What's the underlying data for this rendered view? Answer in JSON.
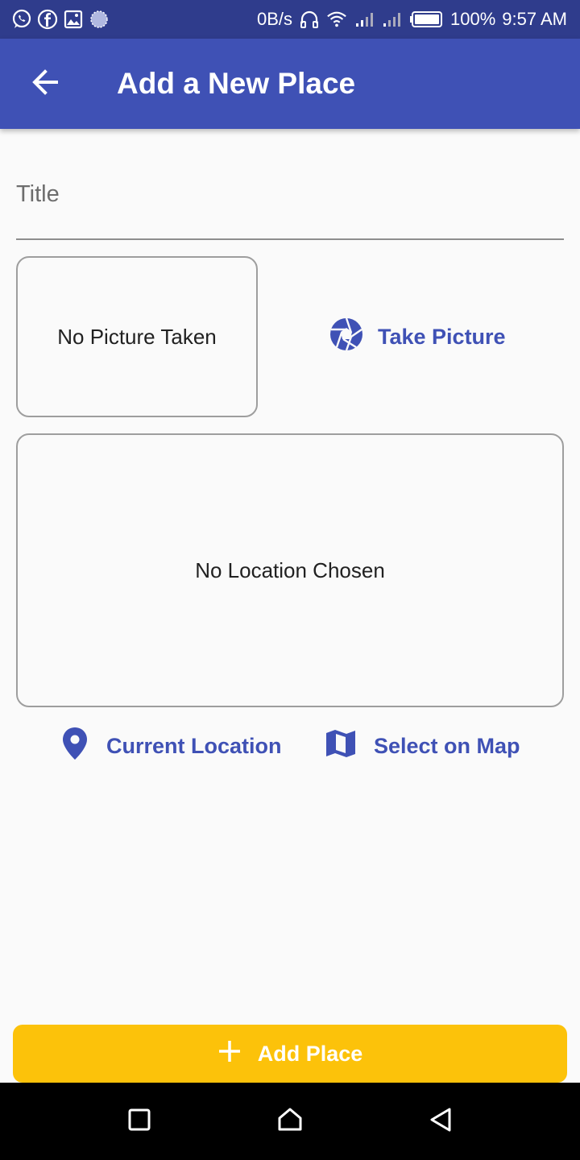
{
  "status_bar": {
    "speed": "0B/s",
    "battery": "100%",
    "time": "9:57 AM",
    "icons": [
      "whatsapp-icon",
      "facebook-icon",
      "gallery-icon",
      "spinner-icon",
      "headset-icon",
      "wifi-icon",
      "signal-icon",
      "signal-icon",
      "battery-icon"
    ]
  },
  "app_bar": {
    "title": "Add a New Place",
    "back_icon": "arrow-back-icon"
  },
  "form": {
    "title_placeholder": "Title",
    "title_value": ""
  },
  "picture": {
    "placeholder": "No Picture Taken",
    "button_label": "Take Picture",
    "button_icon": "camera-shutter-icon"
  },
  "location": {
    "placeholder": "No Location Chosen",
    "current_label": "Current Location",
    "current_icon": "location-pin-icon",
    "map_label": "Select on Map",
    "map_icon": "map-icon"
  },
  "submit": {
    "label": "Add Place",
    "icon": "plus-icon"
  },
  "colors": {
    "primary": "#3f51b5",
    "status_bar": "#2f3c8c",
    "accent": "#fcc20a",
    "background": "#fafafa"
  },
  "nav_bar": {
    "buttons": [
      "recents-icon",
      "home-icon",
      "back-triangle-icon"
    ]
  }
}
